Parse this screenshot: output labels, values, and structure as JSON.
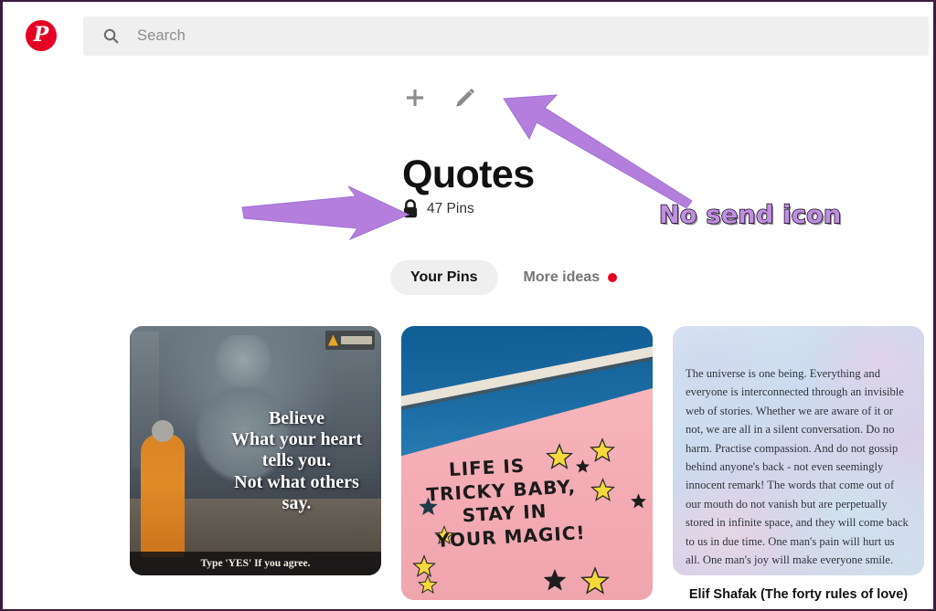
{
  "browser": {
    "border_color": "#3f1b3f"
  },
  "header": {
    "logo_name": "pinterest-logo",
    "logo_glyph": "P",
    "logo_color": "#e60023",
    "search": {
      "icon_name": "search-icon",
      "placeholder": "Search",
      "value": ""
    }
  },
  "board": {
    "actions": [
      {
        "name": "add-pin-button",
        "icon": "plus-icon",
        "label": "Create"
      },
      {
        "name": "edit-board-button",
        "icon": "pencil-icon",
        "label": "Edit board"
      }
    ],
    "title": "Quotes",
    "privacy_icon": "lock-icon",
    "pin_count": "47 Pins",
    "tabs": [
      {
        "name": "tab-your-pins",
        "label": "Your Pins",
        "active": true,
        "has_dot": false
      },
      {
        "name": "tab-more-ideas",
        "label": "More ideas",
        "active": false,
        "has_dot": true
      }
    ],
    "dot_color": "#e60023"
  },
  "pins": [
    {
      "name": "pin-believe-quote",
      "alt": "Buddha statue with monk in orange robe",
      "quote_lines": [
        "Believe",
        "What your heart",
        "tells you.",
        "Not what others",
        "say."
      ],
      "footer": "Type 'YES' If you agree.",
      "caption": ""
    },
    {
      "name": "pin-life-is-tricky",
      "alt": "Pink wall mural with stars",
      "mural_lines": [
        "LIFE IS",
        "TRICKY BABY,",
        "STAY IN",
        "YOUR MAGIC!"
      ],
      "caption": ""
    },
    {
      "name": "pin-elif-shafak-quote",
      "alt": "Watercolor background with long quote",
      "body": "The universe is one being. Everything and everyone is interconnected through an invisible web of stories. Whether we are aware of it or not, we are all in a silent conversation. Do no harm. Practise compassion. And do not gossip behind anyone's back - not even seemingly innocent remark! The words that come out of our mouth do not vanish but are perpetually stored in infinite space, and they will come back to us in due time. One man's pain will hurt us all. One man's joy will make everyone smile.",
      "caption": "Elif Shafak (The forty rules of love)"
    }
  ],
  "annotations": {
    "arrow_color": "#b47fdc",
    "text_color": "#c08fe0",
    "items": [
      {
        "name": "annotation-arrow-to-lock",
        "type": "arrow",
        "direction": "right"
      },
      {
        "name": "annotation-arrow-to-edit",
        "type": "arrow",
        "direction": "up-left"
      },
      {
        "name": "annotation-no-send-icon",
        "type": "text",
        "label": "No send icon"
      }
    ]
  }
}
